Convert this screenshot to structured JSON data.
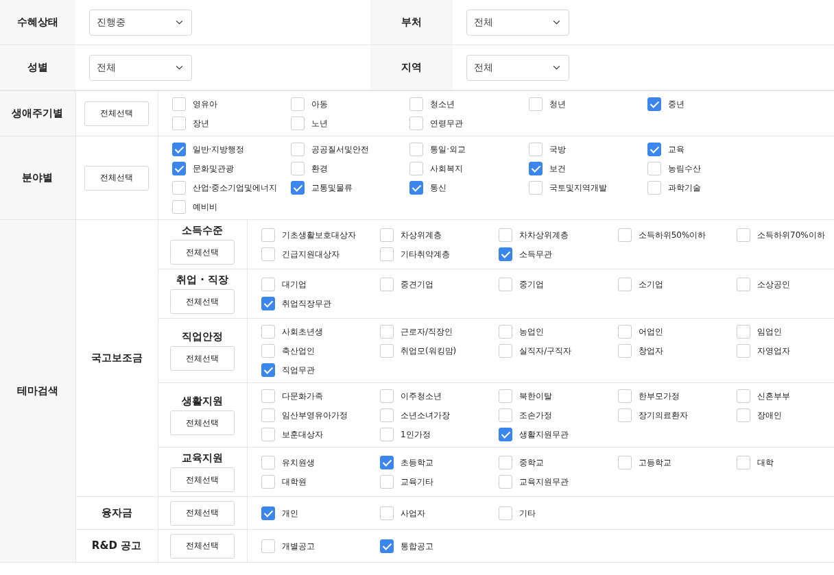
{
  "top_rows": [
    [
      {
        "label": "수혜상태",
        "value": "진행중"
      },
      {
        "label": "부처",
        "value": "전체"
      }
    ],
    [
      {
        "label": "성별",
        "value": "전체"
      },
      {
        "label": "지역",
        "value": "전체"
      }
    ]
  ],
  "categories": [
    {
      "label": "생애주기별",
      "button": "전체선택",
      "options": [
        {
          "label": "영유아",
          "checked": false
        },
        {
          "label": "아동",
          "checked": false
        },
        {
          "label": "청소년",
          "checked": false
        },
        {
          "label": "청년",
          "checked": false
        },
        {
          "label": "중년",
          "checked": true
        },
        {
          "label": "장년",
          "checked": false
        },
        {
          "label": "노년",
          "checked": false
        },
        {
          "label": "연령무관",
          "checked": false
        }
      ]
    },
    {
      "label": "분야별",
      "button": "전체선택",
      "options": [
        {
          "label": "일반·지방행정",
          "checked": true
        },
        {
          "label": "공공질서및안전",
          "checked": false
        },
        {
          "label": "통일·외교",
          "checked": false
        },
        {
          "label": "국방",
          "checked": false
        },
        {
          "label": "교육",
          "checked": true
        },
        {
          "label": "문화및관광",
          "checked": true
        },
        {
          "label": "환경",
          "checked": false
        },
        {
          "label": "사회복지",
          "checked": false
        },
        {
          "label": "보건",
          "checked": true
        },
        {
          "label": "농림수산",
          "checked": false
        },
        {
          "label": "산업·중소기업및에너지",
          "checked": false
        },
        {
          "label": "교통및물류",
          "checked": true
        },
        {
          "label": "통신",
          "checked": true
        },
        {
          "label": "국토및지역개발",
          "checked": false
        },
        {
          "label": "과학기술",
          "checked": false
        },
        {
          "label": "예비비",
          "checked": false
        }
      ]
    }
  ],
  "theme": {
    "label": "테마검색",
    "groups": [
      {
        "label": "국고보조금",
        "subgroups": [
          {
            "label": "소득수준",
            "button": "전체선택",
            "options": [
              {
                "label": "기초생활보호대상자",
                "checked": false
              },
              {
                "label": "차상위계층",
                "checked": false
              },
              {
                "label": "차차상위계층",
                "checked": false
              },
              {
                "label": "소득하위50%이하",
                "checked": false
              },
              {
                "label": "소득하위70%이하",
                "checked": false
              },
              {
                "label": "긴급지원대상자",
                "checked": false
              },
              {
                "label": "기타취약계층",
                "checked": false
              },
              {
                "label": "소득무관",
                "checked": true
              }
            ]
          },
          {
            "label": "취업 · 직장",
            "button": "전체선택",
            "options": [
              {
                "label": "대기업",
                "checked": false
              },
              {
                "label": "중견기업",
                "checked": false
              },
              {
                "label": "중기업",
                "checked": false
              },
              {
                "label": "소기업",
                "checked": false
              },
              {
                "label": "소상공인",
                "checked": false
              },
              {
                "label": "취업직장무관",
                "checked": true
              }
            ]
          },
          {
            "label": "직업안정",
            "button": "전체선택",
            "options": [
              {
                "label": "사회초년생",
                "checked": false
              },
              {
                "label": "근로자/직장인",
                "checked": false
              },
              {
                "label": "농업인",
                "checked": false
              },
              {
                "label": "어업인",
                "checked": false
              },
              {
                "label": "임업인",
                "checked": false
              },
              {
                "label": "축산업인",
                "checked": false
              },
              {
                "label": "취업모(워킹맘)",
                "checked": false
              },
              {
                "label": "실직자/구직자",
                "checked": false
              },
              {
                "label": "창업자",
                "checked": false
              },
              {
                "label": "자영업자",
                "checked": false
              },
              {
                "label": "직업무관",
                "checked": true
              }
            ]
          },
          {
            "label": "생활지원",
            "button": "전체선택",
            "options": [
              {
                "label": "다문화가족",
                "checked": false
              },
              {
                "label": "이주청소년",
                "checked": false
              },
              {
                "label": "북한이탈",
                "checked": false
              },
              {
                "label": "한부모가정",
                "checked": false
              },
              {
                "label": "신혼부부",
                "checked": false
              },
              {
                "label": "임산부영유아가정",
                "checked": false
              },
              {
                "label": "소년소녀가장",
                "checked": false
              },
              {
                "label": "조손가정",
                "checked": false
              },
              {
                "label": "장기의료환자",
                "checked": false
              },
              {
                "label": "장애인",
                "checked": false
              },
              {
                "label": "보훈대상자",
                "checked": false
              },
              {
                "label": "1인가정",
                "checked": false
              },
              {
                "label": "생활지원무관",
                "checked": true
              }
            ]
          },
          {
            "label": "교육지원",
            "button": "전체선택",
            "options": [
              {
                "label": "유치원생",
                "checked": false
              },
              {
                "label": "초등학교",
                "checked": true
              },
              {
                "label": "중학교",
                "checked": false
              },
              {
                "label": "고등학교",
                "checked": false
              },
              {
                "label": "대학",
                "checked": false
              },
              {
                "label": "대학원",
                "checked": false
              },
              {
                "label": "교육기타",
                "checked": false
              },
              {
                "label": "교육지원무관",
                "checked": false
              }
            ]
          }
        ]
      },
      {
        "label": "융자금",
        "button": "전체선택",
        "options": [
          {
            "label": "개인",
            "checked": true
          },
          {
            "label": "사업자",
            "checked": false
          },
          {
            "label": "기타",
            "checked": false
          }
        ]
      },
      {
        "label": "R&D 공고",
        "button": "전체선택",
        "options": [
          {
            "label": "개별공고",
            "checked": false
          },
          {
            "label": "통합공고",
            "checked": true
          }
        ]
      }
    ]
  }
}
